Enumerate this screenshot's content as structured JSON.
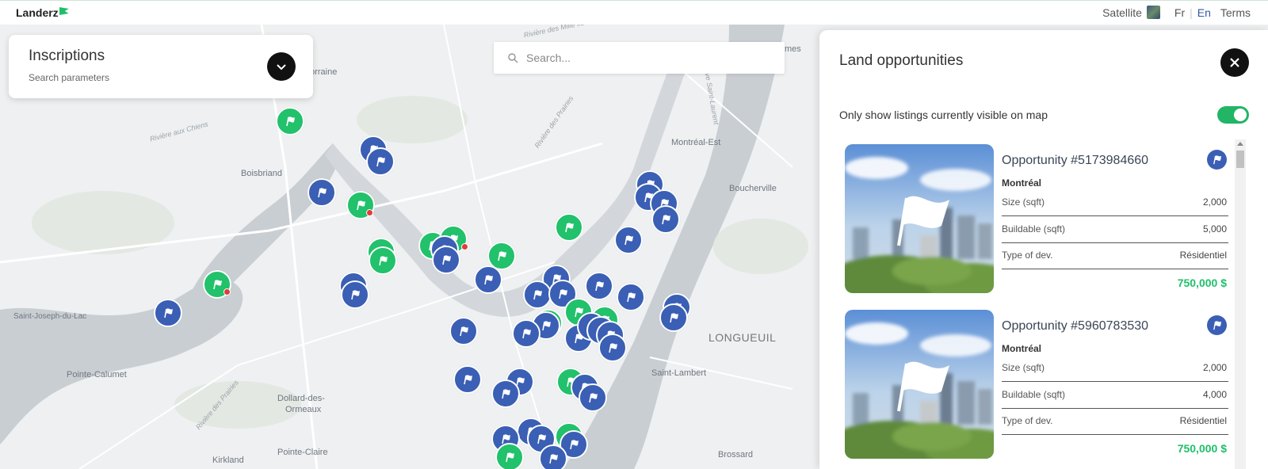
{
  "header": {
    "logo": "Landerz",
    "satellite_label": "Satellite",
    "lang_fr": "Fr",
    "lang_sep": "|",
    "lang_en": "En",
    "terms": "Terms"
  },
  "inscriptions": {
    "title": "Inscriptions",
    "subtitle": "Search parameters"
  },
  "search": {
    "placeholder": "Search..."
  },
  "map_labels": {
    "lorraine": "Lorraine",
    "boisbriand": "Boisbriand",
    "montreal_est": "Montréal-Est",
    "boucherville": "Boucherville",
    "saint_joseph": "Saint-Joseph-du-Lac",
    "longueuil": "LONGUEUIL",
    "pointe_calumet": "Pointe-Calumet",
    "saint_lambert": "Saint-Lambert",
    "dollard1": "Dollard-des-",
    "dollard2": "Ormeaux",
    "pointe_claire": "Pointe-Claire",
    "brossard": "Brossard",
    "kirkland": "Kirkland",
    "mes": "mes",
    "riv_chiens": "Rivière aux Chiens",
    "riv_prairies": "Rivière des Prairies",
    "riv_prairies2": "Rivière des Prairies",
    "riv_mille_iles": "Rivière des Mille Îles",
    "fleuve": "Fleuve Saint-Laurent"
  },
  "panel": {
    "title": "Land opportunities",
    "toggle_label": "Only show listings currently visible on map",
    "toggle_on": true,
    "size_label": "Size (sqft)",
    "buildable_label": "Buildable (sqft)",
    "type_label": "Type of dev.",
    "listings": [
      {
        "title": "Opportunity #5173984660",
        "city": "Montréal",
        "size": "2,000",
        "buildable": "5,000",
        "type": "Résidentiel",
        "price": "750,000 $"
      },
      {
        "title": "Opportunity #5960783530",
        "city": "Montréal",
        "size": "2,000",
        "buildable": "4,000",
        "type": "Résidentiel",
        "price": "750,000 $"
      }
    ]
  },
  "colors": {
    "accent_green": "#22c16b",
    "marker_blue": "#3a5fb4",
    "price_green": "#1fbf6a"
  }
}
